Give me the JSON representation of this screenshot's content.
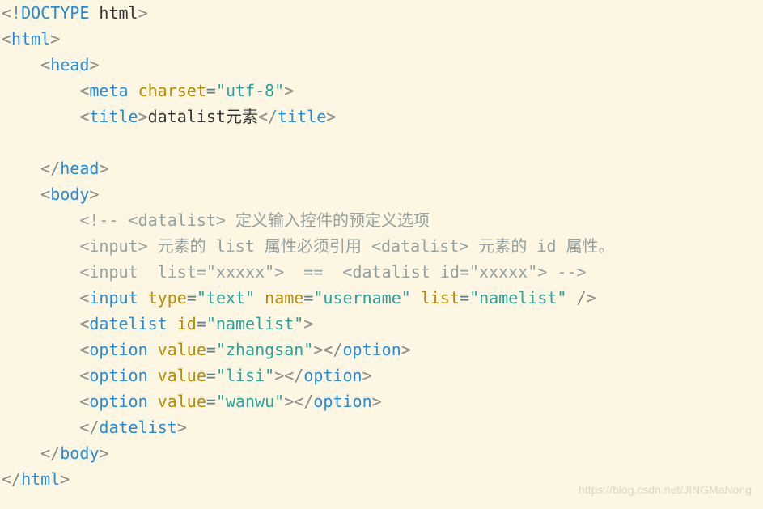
{
  "watermark": "https://blog.csdn.net/JINGMaNong",
  "code": {
    "l01": {
      "open": "<!",
      "tag": "DOCTYPE",
      "rest": " html",
      "close": ">"
    },
    "l02": {
      "open": "<",
      "tag": "html",
      "close": ">"
    },
    "l03": {
      "open": "<",
      "tag": "head",
      "close": ">"
    },
    "l04": {
      "open": "<",
      "tag": "meta",
      "a1": "charset",
      "eq1": "=",
      "v1": "\"utf-8\"",
      "close": ">"
    },
    "l05": {
      "open1": "<",
      "tag1": "title",
      "close1": ">",
      "text": "datalist元素",
      "open2": "</",
      "tag2": "title",
      "close2": ">"
    },
    "l06": {
      "open": "</",
      "tag": "head",
      "close": ">"
    },
    "l07": {
      "open": "<",
      "tag": "body",
      "close": ">"
    },
    "c1": "<!-- <datalist> 定义输入控件的预定义选项",
    "c2": "<input> 元素的 list 属性必须引用 <datalist> 元素的 id 属性。",
    "c3": "<input  list=\"xxxxx\">  ==  <datalist id=\"xxxxx\"> -->",
    "l08": {
      "open": "<",
      "tag": "input",
      "a1": "type",
      "eq1": "=",
      "v1": "\"text\"",
      "a2": "name",
      "eq2": "=",
      "v2": "\"username\"",
      "a3": "list",
      "eq3": "=",
      "v3": "\"namelist\"",
      "close": " />"
    },
    "l09": {
      "open": "<",
      "tag": "datelist",
      "a1": "id",
      "eq1": "=",
      "v1": "\"namelist\"",
      "close": ">"
    },
    "l10": {
      "open1": "<",
      "tag1": "option",
      "a1": "value",
      "eq1": "=",
      "v1": "\"zhangsan\"",
      "close1": "></",
      "tag2": "option",
      "close2": ">"
    },
    "l11": {
      "open1": "<",
      "tag1": "option",
      "a1": "value",
      "eq1": "=",
      "v1": "\"lisi\"",
      "close1": "></",
      "tag2": "option",
      "close2": ">"
    },
    "l12": {
      "open1": "<",
      "tag1": "option",
      "a1": "value",
      "eq1": "=",
      "v1": "\"wanwu\"",
      "close1": "></",
      "tag2": "option",
      "close2": ">"
    },
    "l13": {
      "open": "</",
      "tag": "datelist",
      "close": ">"
    },
    "l14": {
      "open": "</",
      "tag": "body",
      "close": ">"
    },
    "l15": {
      "open": "</",
      "tag": "html",
      "close": ">"
    }
  }
}
